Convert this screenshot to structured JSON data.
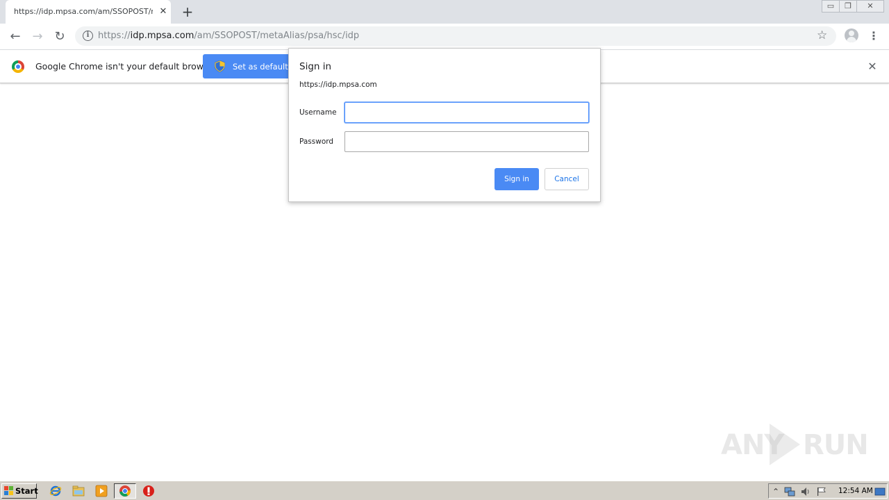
{
  "browser": {
    "tab": {
      "title": "https://idp.mpsa.com/am/SSOPOST/metaAlias/psa/hsc/idp",
      "close_symbol": "✕"
    },
    "new_tab_symbol": "+",
    "window_controls": {
      "minimize": "▭",
      "restore": "❐",
      "close": "✕"
    },
    "toolbar": {
      "back_symbol": "←",
      "forward_symbol": "→",
      "reload_symbol": "↻",
      "url_scheme": "https://",
      "url_host": "idp.mpsa.com",
      "url_path": "/am/SSOPOST/metaAlias/psa/hsc/idp",
      "info_symbol": "i",
      "star_symbol": "☆",
      "menu_symbol": "⋮"
    },
    "infobar": {
      "message": "Google Chrome isn't your default browser",
      "button_label": "Set as default",
      "close_symbol": "✕"
    }
  },
  "dialog": {
    "title": "Sign in",
    "origin": "https://idp.mpsa.com",
    "username_label": "Username",
    "username_value": "",
    "password_label": "Password",
    "password_value": "",
    "signin_label": "Sign in",
    "cancel_label": "Cancel"
  },
  "watermark": {
    "left": "ANY",
    "right": "RUN"
  },
  "taskbar": {
    "start_label": "Start",
    "clock": "12:54 AM",
    "tray_up_symbol": "⌃"
  },
  "colors": {
    "accent": "#4a8af4",
    "tabstrip": "#dee1e6",
    "taskbar": "#d4d0c8"
  }
}
